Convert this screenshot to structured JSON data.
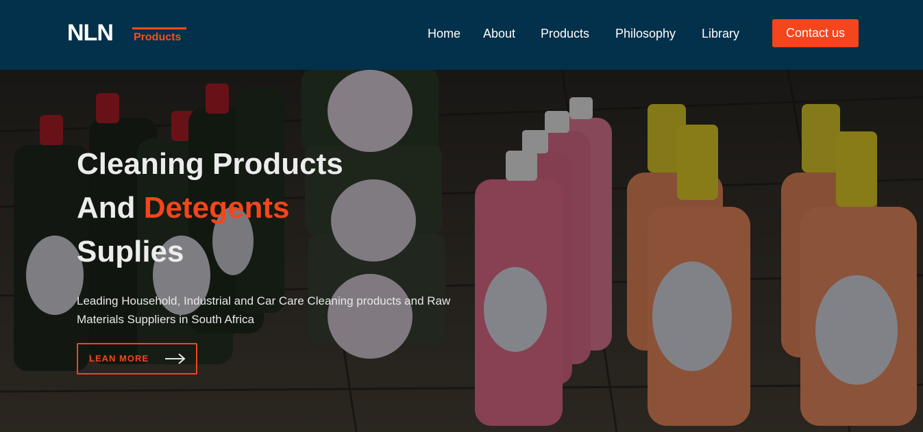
{
  "brand": {
    "logo_main": "NLN",
    "logo_sub": "Products",
    "accent_color": "#f5451c",
    "nav_bg": "#03304a"
  },
  "nav": {
    "items": [
      {
        "label": "Home"
      },
      {
        "label": "About"
      },
      {
        "label": "Products"
      },
      {
        "label": "Philosophy"
      },
      {
        "label": "Library"
      }
    ],
    "contact_label": "Contact us"
  },
  "hero": {
    "title_line1": "Cleaning Products",
    "title_line2_prefix": "And ",
    "title_line2_accent": "Detegents",
    "title_line3": "Suplies",
    "subtitle": "Leading Household, Industrial and Car Care Cleaning products and Raw Materials Suppliers in South Africa",
    "cta_label": "LEAN MORE",
    "cta_icon": "arrow-right-icon",
    "background_icon": "product-photo"
  }
}
